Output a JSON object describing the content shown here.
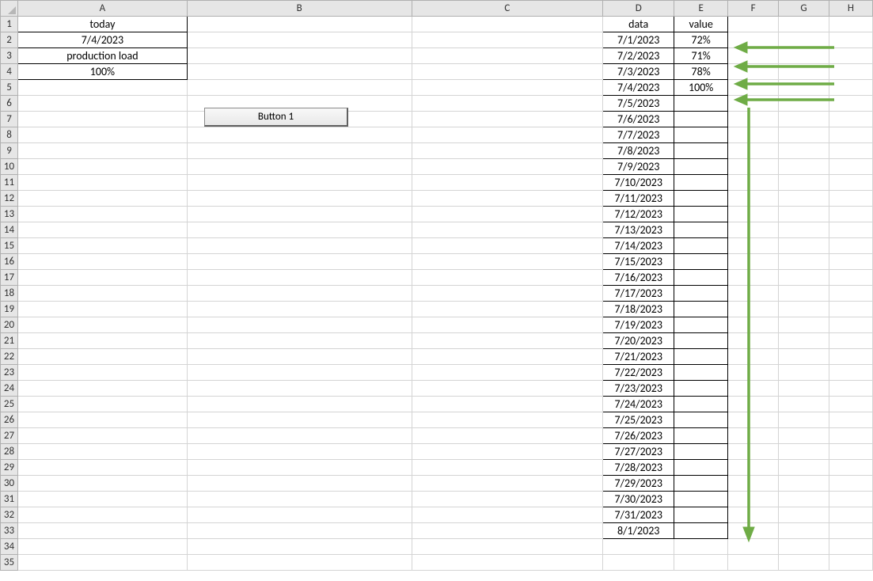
{
  "columns": [
    "A",
    "B",
    "C",
    "D",
    "E",
    "F",
    "G",
    "H"
  ],
  "row_count": 35,
  "summary": {
    "a1": "today",
    "a2": "7/4/2023",
    "a3": "production load",
    "a4": "100%"
  },
  "table": {
    "header_d": "data",
    "header_e": "value",
    "rows": [
      {
        "d": "7/1/2023",
        "e": "72%"
      },
      {
        "d": "7/2/2023",
        "e": "71%"
      },
      {
        "d": "7/3/2023",
        "e": "78%"
      },
      {
        "d": "7/4/2023",
        "e": "100%"
      },
      {
        "d": "7/5/2023",
        "e": ""
      },
      {
        "d": "7/6/2023",
        "e": ""
      },
      {
        "d": "7/7/2023",
        "e": ""
      },
      {
        "d": "7/8/2023",
        "e": ""
      },
      {
        "d": "7/9/2023",
        "e": ""
      },
      {
        "d": "7/10/2023",
        "e": ""
      },
      {
        "d": "7/11/2023",
        "e": ""
      },
      {
        "d": "7/12/2023",
        "e": ""
      },
      {
        "d": "7/13/2023",
        "e": ""
      },
      {
        "d": "7/14/2023",
        "e": ""
      },
      {
        "d": "7/15/2023",
        "e": ""
      },
      {
        "d": "7/16/2023",
        "e": ""
      },
      {
        "d": "7/17/2023",
        "e": ""
      },
      {
        "d": "7/18/2023",
        "e": ""
      },
      {
        "d": "7/19/2023",
        "e": ""
      },
      {
        "d": "7/20/2023",
        "e": ""
      },
      {
        "d": "7/21/2023",
        "e": ""
      },
      {
        "d": "7/22/2023",
        "e": ""
      },
      {
        "d": "7/23/2023",
        "e": ""
      },
      {
        "d": "7/24/2023",
        "e": ""
      },
      {
        "d": "7/25/2023",
        "e": ""
      },
      {
        "d": "7/26/2023",
        "e": ""
      },
      {
        "d": "7/27/2023",
        "e": ""
      },
      {
        "d": "7/28/2023",
        "e": ""
      },
      {
        "d": "7/29/2023",
        "e": ""
      },
      {
        "d": "7/30/2023",
        "e": ""
      },
      {
        "d": "7/31/2023",
        "e": ""
      },
      {
        "d": "8/1/2023",
        "e": ""
      }
    ]
  },
  "button_label": "Button 1",
  "arrow_color": "#6fac46"
}
